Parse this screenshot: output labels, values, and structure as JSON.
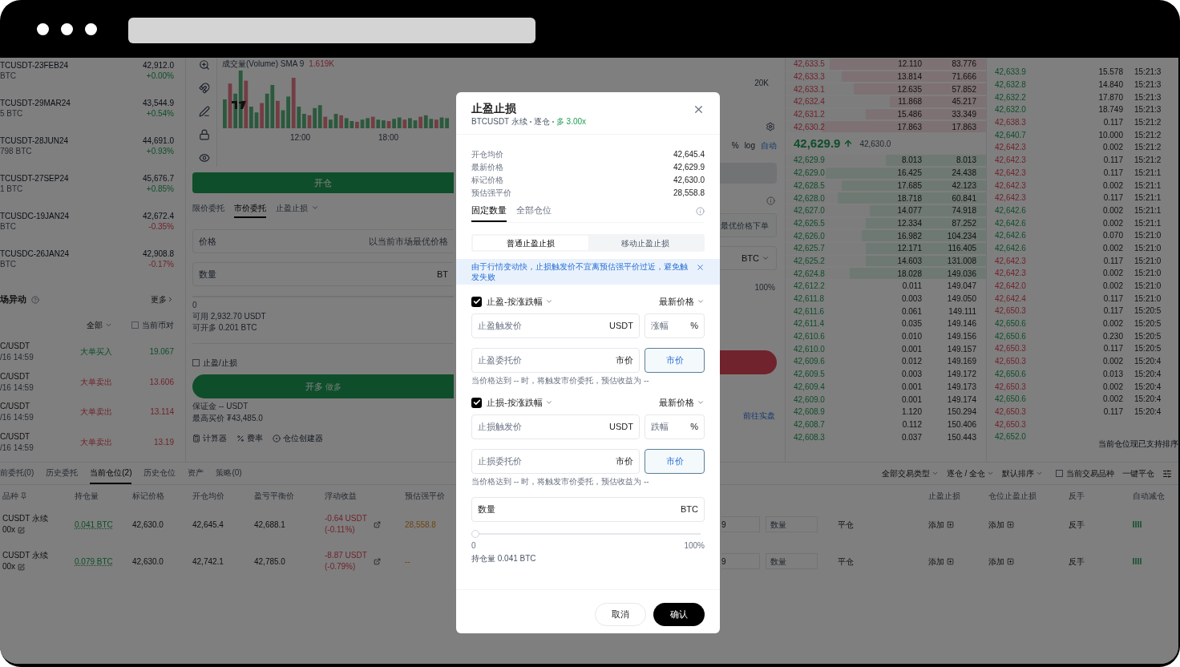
{
  "contracts": [
    {
      "name": "TCUSDT-23FEB24",
      "volume": "BTC",
      "price": "42,912.0",
      "change": "+0.00%",
      "rising": true
    },
    {
      "name": "TCUSDT-29MAR24",
      "volume": "5 BTC",
      "price": "43,544.9",
      "change": "+0.54%",
      "rising": true
    },
    {
      "name": "TCUSDT-28JUN24",
      "volume": "798 BTC",
      "price": "44,691.0",
      "change": "+0.93%",
      "rising": true
    },
    {
      "name": "TCUSDT-27SEP24",
      "volume": "1 BTC",
      "price": "45,676.7",
      "change": "+0.85%",
      "rising": true
    },
    {
      "name": "TCUSDC-19JAN24",
      "volume": "BTC",
      "price": "42,672.4",
      "change": "-0.35%",
      "rising": false
    },
    {
      "name": "TCUSDC-26JAN24",
      "volume": "BTC",
      "price": "42,908.8",
      "change": "-0.17%",
      "rising": false
    }
  ],
  "market_moves": {
    "title": "场异动",
    "more": "更多",
    "filter": "全部",
    "current_pair": {
      "label": "当前币对",
      "checked": false
    },
    "items": [
      {
        "pair": "C/USDT",
        "time": "/16 14:59",
        "type": "大单买入",
        "buy": true,
        "amount": "19.067"
      },
      {
        "pair": "C/USDT",
        "time": "/16 14:59",
        "type": "大单卖出",
        "buy": false,
        "amount": "13.606"
      },
      {
        "pair": "C/USDT",
        "time": "/16 14:59",
        "type": "大单卖出",
        "buy": false,
        "amount": "13.114"
      },
      {
        "pair": "C/USDT",
        "time": "/16 14:59",
        "type": "大单卖出",
        "buy": false,
        "amount": "13.19"
      }
    ]
  },
  "chart": {
    "volume_label": "成交量(Volume) SMA 9",
    "volume_value": "1.619K",
    "times": [
      "12:00",
      "18:00"
    ],
    "axis_label": "20K",
    "scale_options": [
      {
        "label": "%",
        "selected": false
      },
      {
        "label": "log",
        "selected": false
      },
      {
        "label": "自动",
        "selected": true
      }
    ]
  },
  "order_form": {
    "open_tab": "开仓",
    "order_tabs": [
      {
        "label": "限价委托",
        "selected": false
      },
      {
        "label": "市价委托",
        "selected": true
      },
      {
        "label": "止盈止损",
        "selected": false
      }
    ],
    "price_label": "价格",
    "price_hint": "以当前市场最优价格",
    "price_hint_right": "最优价格下单",
    "quantity_label": "数量",
    "quantity_unit_left": "BT",
    "quantity_unit": "BTC",
    "slider_min": "0",
    "slider_max": "100%",
    "available": "可用 2,932.70 USDT",
    "can_open": "可开多 0.201 BTC",
    "tp_sl": {
      "label": "止盈/止损",
      "checked": false
    },
    "long_button": "开多",
    "long_sub": "做多",
    "margin": "保证金 -- USDT",
    "max_price": "最高买价 ₮43,485.0",
    "tools": [
      "计算器",
      "费率",
      "仓位创建器"
    ],
    "go_live": "前往实盘"
  },
  "order_book": {
    "asks": [
      {
        "price": "42,633.5",
        "amount": "12.110",
        "total": "83.776",
        "level": 0.78
      },
      {
        "price": "42,633.3",
        "amount": "13.814",
        "total": "71.666",
        "level": 0.72
      },
      {
        "price": "42,633.1",
        "amount": "12.635",
        "total": "57.852",
        "level": 0.66
      },
      {
        "price": "42,632.4",
        "amount": "11.868",
        "total": "45.217",
        "level": 0.48
      },
      {
        "price": "42,631.2",
        "amount": "15.486",
        "total": "33.349",
        "level": 0.6
      },
      {
        "price": "42,630.2",
        "amount": "17.863",
        "total": "17.863",
        "level": 0.82
      }
    ],
    "last_price": "42,629.9",
    "mark_price": "42,630.0",
    "bids": [
      {
        "price": "42,629.9",
        "amount": "8.013",
        "total": "8.013",
        "level": 0.5
      },
      {
        "price": "42,629.0",
        "amount": "16.425",
        "total": "24.438",
        "level": 0.8
      },
      {
        "price": "42,628.5",
        "amount": "17.685",
        "total": "42.123",
        "level": 0.72
      },
      {
        "price": "42,628.0",
        "amount": "18.718",
        "total": "60.841",
        "level": 0.74
      },
      {
        "price": "42,627.0",
        "amount": "14.077",
        "total": "74.918",
        "level": 0.58
      },
      {
        "price": "42,626.5",
        "amount": "12.334",
        "total": "87.252",
        "level": 0.6
      },
      {
        "price": "42,626.0",
        "amount": "16.982",
        "total": "104.234",
        "level": 0.62
      },
      {
        "price": "42,625.7",
        "amount": "12.171",
        "total": "116.405",
        "level": 0.6
      },
      {
        "price": "42,625.2",
        "amount": "14.603",
        "total": "131.008",
        "level": 0.6
      },
      {
        "price": "42,624.8",
        "amount": "18.028",
        "total": "149.036",
        "level": 0.68
      },
      {
        "price": "42,612.2",
        "amount": "0.011",
        "total": "149.047"
      },
      {
        "price": "42,611.8",
        "amount": "0.003",
        "total": "149.050"
      },
      {
        "price": "42,611.6",
        "amount": "0.061",
        "total": "149.111"
      },
      {
        "price": "42,611.4",
        "amount": "0.035",
        "total": "149.146"
      },
      {
        "price": "42,610.6",
        "amount": "0.010",
        "total": "149.156"
      },
      {
        "price": "42,610.0",
        "amount": "0.001",
        "total": "149.157"
      },
      {
        "price": "42,609.6",
        "amount": "0.012",
        "total": "149.169"
      },
      {
        "price": "42,609.5",
        "amount": "0.003",
        "total": "149.172"
      },
      {
        "price": "42,609.4",
        "amount": "0.001",
        "total": "149.173"
      },
      {
        "price": "42,609.0",
        "amount": "0.001",
        "total": "149.174"
      },
      {
        "price": "42,608.9",
        "amount": "1.120",
        "total": "150.294"
      },
      {
        "price": "42,608.7",
        "amount": "0.112",
        "total": "150.406"
      },
      {
        "price": "42,608.3",
        "amount": "0.037",
        "total": "150.443"
      }
    ]
  },
  "trades": [
    {
      "price": "42,633.9",
      "buy": true,
      "amount": "15.578",
      "time": "15:21:3"
    },
    {
      "price": "42,632.8",
      "buy": true,
      "amount": "14.840",
      "time": "15:21:3"
    },
    {
      "price": "42,632.2",
      "buy": true,
      "amount": "17.870",
      "time": "15:21:3"
    },
    {
      "price": "42,632.0",
      "buy": true,
      "amount": "18.749",
      "time": "15:21:3"
    },
    {
      "price": "42,638.3",
      "buy": false,
      "amount": "0.117",
      "time": "15:21:2"
    },
    {
      "price": "42,640.7",
      "buy": true,
      "amount": "10.000",
      "time": "15:21:2"
    },
    {
      "price": "42,642.3",
      "buy": false,
      "amount": "0.002",
      "time": "15:21:2"
    },
    {
      "price": "42,642.3",
      "buy": false,
      "amount": "0.117",
      "time": "15:21:2"
    },
    {
      "price": "42,642.3",
      "buy": false,
      "amount": "0.117",
      "time": "15:21:1"
    },
    {
      "price": "42,642.3",
      "buy": false,
      "amount": "0.002",
      "time": "15:21:1"
    },
    {
      "price": "42,642.3",
      "buy": false,
      "amount": "0.117",
      "time": "15:21:1"
    },
    {
      "price": "42,642.6",
      "buy": true,
      "amount": "0.002",
      "time": "15:21:1"
    },
    {
      "price": "42,642.6",
      "buy": true,
      "amount": "0.002",
      "time": "15:21:1"
    },
    {
      "price": "42,642.6",
      "buy": true,
      "amount": "0.070",
      "time": "15:21:0"
    },
    {
      "price": "42,642.6",
      "buy": true,
      "amount": "0.002",
      "time": "15:21:0"
    },
    {
      "price": "42,642.3",
      "buy": false,
      "amount": "0.117",
      "time": "15:21:0"
    },
    {
      "price": "42,642.3",
      "buy": false,
      "amount": "0.002",
      "time": "15:21:0"
    },
    {
      "price": "42,642.0",
      "buy": false,
      "amount": "0.002",
      "time": "15:21:0"
    },
    {
      "price": "42,642.4",
      "buy": false,
      "amount": "0.117",
      "time": "15:21:0"
    },
    {
      "price": "42,650.3",
      "buy": false,
      "amount": "0.117",
      "time": "15:20:5"
    },
    {
      "price": "42,650.6",
      "buy": true,
      "amount": "0.002",
      "time": "15:20:5"
    },
    {
      "price": "42,650.6",
      "buy": true,
      "amount": "0.230",
      "time": "15:20:5"
    },
    {
      "price": "42,650.3",
      "buy": false,
      "amount": "0.117",
      "time": "15:20:5"
    },
    {
      "price": "42,650.3",
      "buy": false,
      "amount": "0.002",
      "time": "15:20:4"
    },
    {
      "price": "42,650.6",
      "buy": true,
      "amount": "0.013",
      "time": "15:20:4"
    },
    {
      "price": "42,650.3",
      "buy": false,
      "amount": "0.002",
      "time": "15:20:4"
    },
    {
      "price": "42,650.6",
      "buy": true,
      "amount": "0.002",
      "time": "15:20:4"
    },
    {
      "price": "42,650.3",
      "buy": false,
      "amount": "0.117",
      "time": "15:20:4"
    },
    {
      "price": "42,650.3",
      "buy": false
    },
    {
      "price": "42,652.0",
      "buy": true
    }
  ],
  "sort_tooltip": "当前仓位现已支持排序",
  "positions": {
    "tabs": [
      {
        "label": "前委托(0)",
        "selected": false
      },
      {
        "label": "历史委托",
        "selected": false
      },
      {
        "label": "当前仓位(2)",
        "selected": true
      },
      {
        "label": "历史仓位",
        "selected": false
      },
      {
        "label": "资产",
        "selected": false
      },
      {
        "label": "策略(0)",
        "selected": false
      }
    ],
    "filters": [
      "全部交易类型",
      "逐仓 / 全仓",
      "默认排序"
    ],
    "current_symbol": {
      "label": "当前交易品种",
      "checked": false
    },
    "close_all": "一键平仓",
    "columns_left": [
      "品种",
      "持仓量",
      "标记价格",
      "开仓均价",
      "盈亏平衡价",
      "浮动收益",
      "预估强平价"
    ],
    "columns_right": [
      "止盈止损",
      "仓位止盈止损",
      "反手",
      "自动减仓"
    ],
    "rows": [
      {
        "symbol": "CUSDT 永续",
        "leverage": "00x",
        "size": "0.041 BTC",
        "mark": "42,630.0",
        "entry": "42,645.4",
        "breakeven": "42,688.1",
        "pnl": "-0.64 USDT",
        "pnl_pct": "(-0.11%)",
        "liq": "28,558.8",
        "price_input": "9",
        "qty_placeholder": "数量",
        "close": "平仓",
        "tp_sl": "添加",
        "pos_tp_sl": "添加",
        "reverse": "反手"
      },
      {
        "symbol": "CUSDT 永续",
        "leverage": "00x",
        "size": "0.079 BTC",
        "mark": "42,630.0",
        "entry": "42,742.1",
        "breakeven": "42,785.0",
        "pnl": "-8.87 USDT",
        "pnl_pct": "(-0.79%)",
        "liq": "--",
        "price_input": "9",
        "qty_placeholder": "数量",
        "close": "平仓",
        "tp_sl": "添加",
        "pos_tp_sl": "添加",
        "reverse": "反手"
      }
    ]
  },
  "modal": {
    "title": "止盈止损",
    "symbol": "BTCUSDT 永续",
    "margin_mode": "逐仓",
    "position": "多 3.00x",
    "long": true,
    "info": [
      {
        "label": "开仓均价",
        "value": "42,645.4"
      },
      {
        "label": "最新价格",
        "value": "42,629.9"
      },
      {
        "label": "标记价格",
        "value": "42,630.0"
      },
      {
        "label": "预估强平价",
        "value": "28,558.8"
      }
    ],
    "tabs": [
      {
        "label": "固定数量",
        "selected": true
      },
      {
        "label": "全部仓位",
        "selected": false
      }
    ],
    "modes": [
      {
        "label": "普通止盈止损",
        "selected": true
      },
      {
        "label": "移动止盈止损",
        "selected": false
      }
    ],
    "alert": "由于行情变动快，止损触发价不宜离预估强平价过近，避免触发失败",
    "sections": [
      {
        "checked": true,
        "label": "止盈-按涨跌幅",
        "price_type": "最新价格",
        "trigger_placeholder": "止盈触发价",
        "trigger_unit": "USDT",
        "pct_placeholder": "涨幅",
        "pct_unit": "%",
        "order_placeholder": "止盈委托价",
        "order_unit": "市价",
        "market_button": {
          "label": "市价",
          "selected": true
        },
        "hint": "当价格达到 -- 时，将触发市价委托，预估收益为 --"
      },
      {
        "checked": true,
        "label": "止损-按涨跌幅",
        "price_type": "最新价格",
        "trigger_placeholder": "止损触发价",
        "trigger_unit": "USDT",
        "pct_placeholder": "跌幅",
        "pct_unit": "%",
        "order_placeholder": "止损委托价",
        "order_unit": "市价",
        "market_button": {
          "label": "市价",
          "selected": true
        },
        "hint": "当价格达到 -- 时，将触发市价委托，预估收益为 --"
      }
    ],
    "quantity_label": "数量",
    "quantity_unit": "BTC",
    "slider": {
      "level": 0,
      "min": "0",
      "max": "100%"
    },
    "holding": "持仓量 0.041 BTC",
    "cancel": "取消",
    "confirm": "确认"
  }
}
